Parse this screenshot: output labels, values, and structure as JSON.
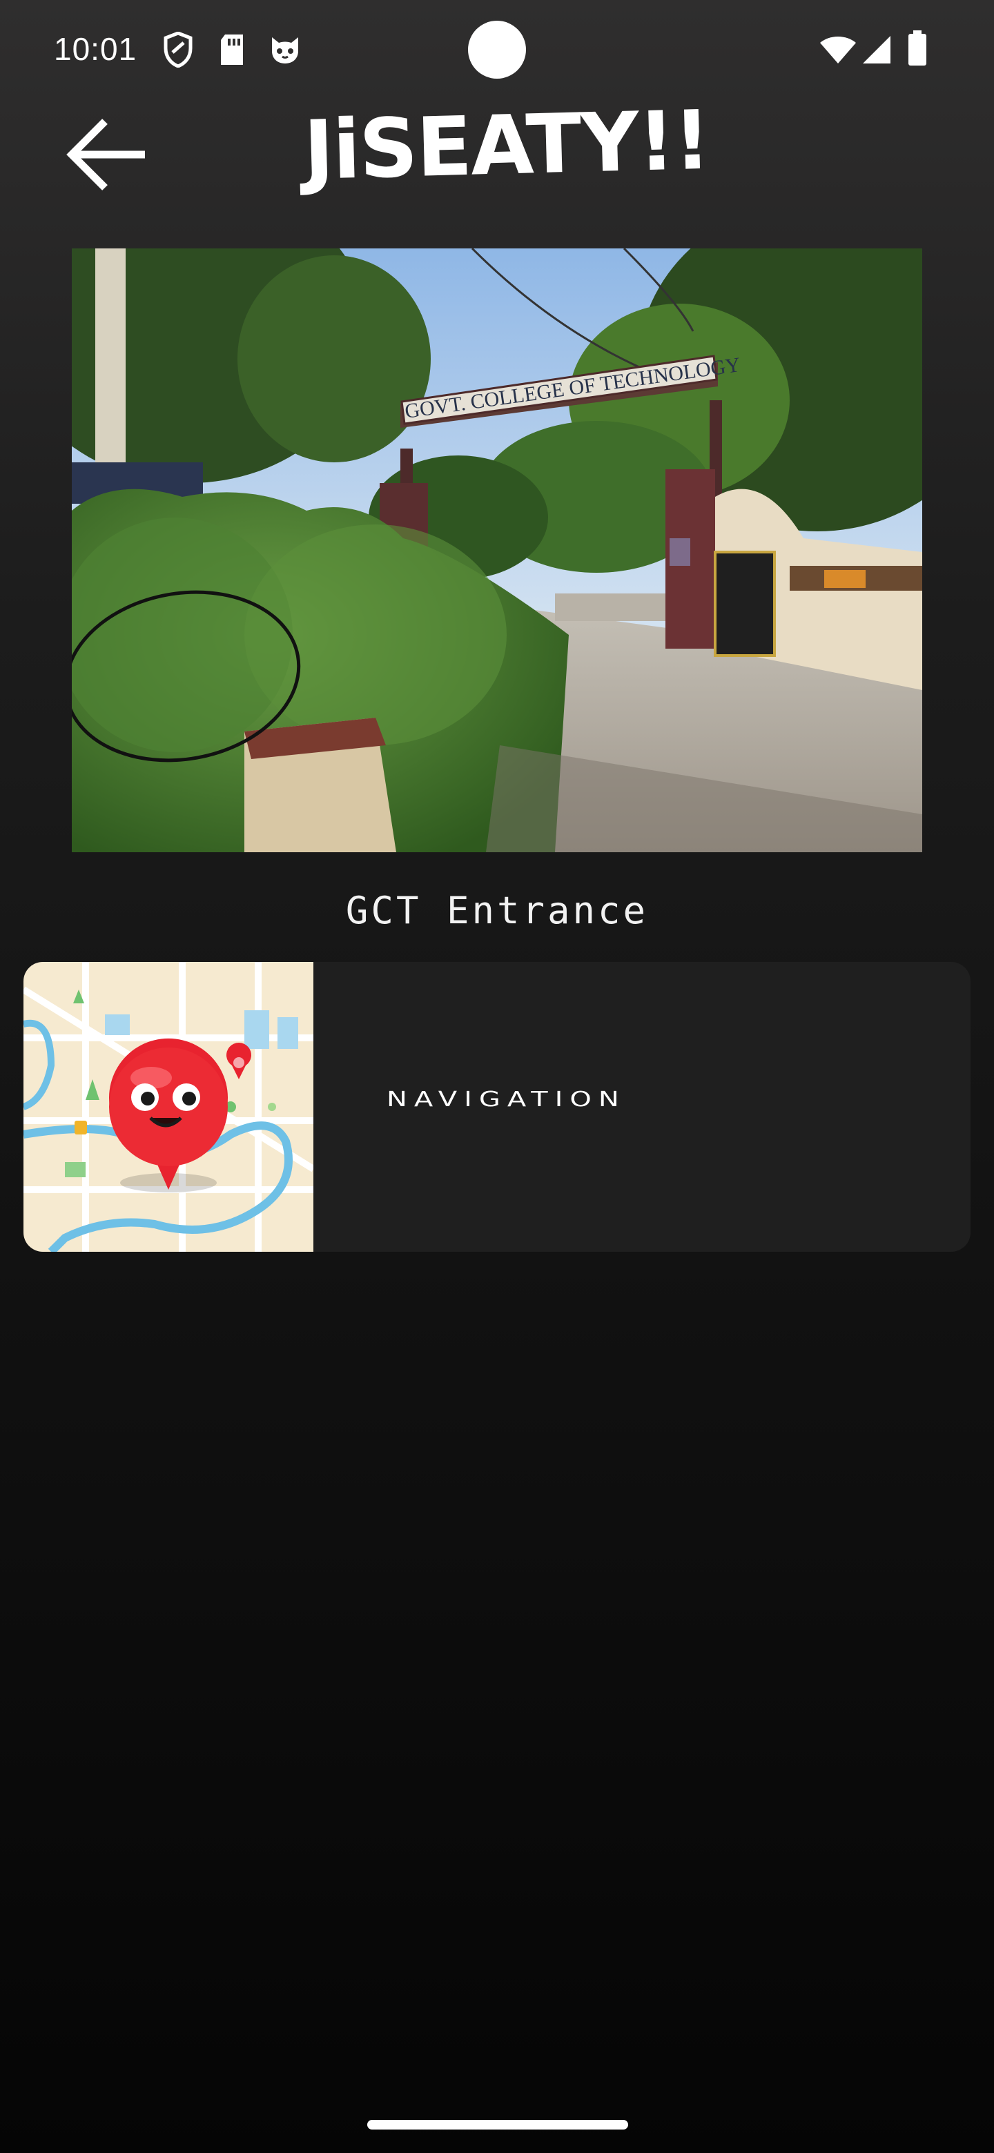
{
  "status_bar": {
    "time": "10:01",
    "left_icons": [
      "shield-icon",
      "sd-card-icon",
      "cat-face-icon"
    ],
    "right_icons": [
      "wifi-icon",
      "cellular-signal-icon",
      "battery-icon"
    ]
  },
  "app_bar": {
    "back_icon": "arrow-left-icon",
    "title": "JiSEATY!!"
  },
  "hero": {
    "gate_sign_text": "GOVT. COLLEGE OF TECHNOLOGY",
    "caption": "GCT Entrance"
  },
  "nav_card": {
    "thumbnail_icon": "map-pin-mascot-icon",
    "label": "NAVIGATION"
  },
  "colors": {
    "background_top": "#2f2e2e",
    "background_bottom": "#050505",
    "card": "#1f1f1f",
    "text": "#ffffff",
    "pin_red": "#e8232f"
  }
}
